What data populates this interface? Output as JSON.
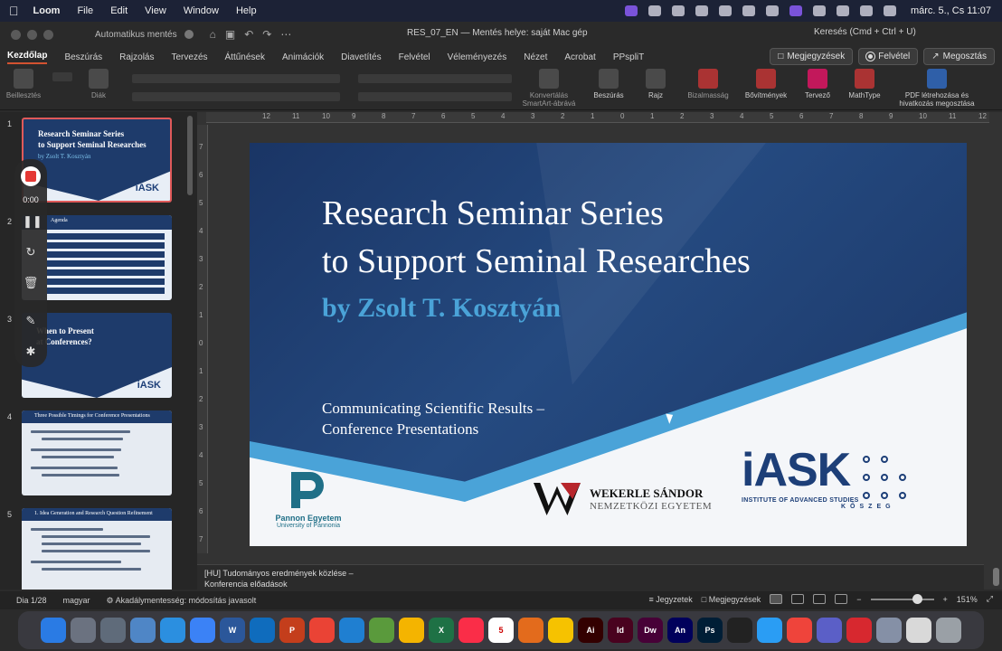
{
  "menubar": {
    "app": "Loom",
    "items": [
      "File",
      "Edit",
      "View",
      "Window",
      "Help"
    ],
    "clock": "márc. 5., Cs 11:07"
  },
  "window": {
    "autosave": "Automatikus mentés",
    "doc_title": "RES_07_EN — Mentés helye: saját Mac gép",
    "search": "Keresés (Cmd + Ctrl + U)"
  },
  "ribbon_tabs": [
    "Kezdőlap",
    "Beszúrás",
    "Rajzolás",
    "Tervezés",
    "Áttűnések",
    "Animációk",
    "Diavetítés",
    "Felvétel",
    "Véleményezés",
    "Nézet",
    "Acrobat",
    "PPspliT"
  ],
  "ribbon_actions": {
    "comments": "Megjegyzések",
    "record": "Felvétel",
    "share": "Megosztás"
  },
  "ribbon_groups": {
    "paste": "Beillesztés",
    "slides": "Diák",
    "convert": "Konvertálás\nSmartArt-ábrává",
    "insert": "Beszúrás",
    "draw": "Rajz",
    "sensitivity": "Bizalmasság",
    "addins": "Bővítmények",
    "designer": "Tervező",
    "mathtype": "MathType",
    "pdf": "PDF létrehozása és\nhivatkozás megosztása"
  },
  "recorder": {
    "time": "0:00"
  },
  "thumbnails": [
    {
      "num": "1",
      "title": "Research Seminar Series\nto Support Seminal Researches",
      "sub": "by Zsolt T. Kosztyán"
    },
    {
      "num": "2",
      "title": "Agenda"
    },
    {
      "num": "3",
      "title": "When to Present\nat Conferences?"
    },
    {
      "num": "4",
      "title": "Three Possible Timings for Conference Presentations"
    },
    {
      "num": "5",
      "title": "1. Idea Generation and Research Question Refinement"
    }
  ],
  "ruler": {
    "top": [
      "12",
      "11",
      "10",
      "9",
      "8",
      "7",
      "6",
      "5",
      "4",
      "3",
      "2",
      "1",
      "0",
      "1",
      "2",
      "3",
      "4",
      "5",
      "6",
      "7",
      "8",
      "9",
      "10",
      "11",
      "12"
    ],
    "left": [
      "7",
      "6",
      "5",
      "4",
      "3",
      "2",
      "1",
      "0",
      "1",
      "2",
      "3",
      "4",
      "5",
      "6",
      "7"
    ]
  },
  "slide": {
    "title_line1": "Research Seminar Series",
    "title_line2": "to Support Seminal Researches",
    "author": "by Zsolt T. Kosztyán",
    "subtitle_line1": "Communicating Scientific Results –",
    "subtitle_line2": "Conference Presentations",
    "pannon_name": "Pannon Egyetem",
    "pannon_sub": "University of Pannonia",
    "wekerle_1": "WEKERLE SÁNDOR",
    "wekerle_2": "NEMZETKÖZI EGYETEM",
    "iask": "iASK",
    "iask_inst": "INSTITUTE OF ADVANCED STUDIES",
    "iask_city": "KŐSZEG",
    "colors": {
      "navy": "#1c3a6a",
      "accent": "#4aa3d8",
      "iask": "#1d3f78"
    }
  },
  "notes": {
    "line1": "[HU] Tudományos eredmények közlése –",
    "line2": "Konferencia előadások"
  },
  "statusbar": {
    "slide": "Dia 1/28",
    "lang": "magyar",
    "accessibility": "Akadálymentesség: módosítás javasolt",
    "notes": "Jegyzetek",
    "comments": "Megjegyzések",
    "zoom": "151%"
  },
  "dock": [
    {
      "name": "Finder",
      "color": "#2a7be4"
    },
    {
      "name": "Launchpad",
      "color": "#6b7280"
    },
    {
      "name": "System Settings",
      "color": "#5f6b7a"
    },
    {
      "name": "Preview",
      "color": "#4f86c6"
    },
    {
      "name": "Safari",
      "color": "#2b8fe0"
    },
    {
      "name": "Mail",
      "color": "#3b82f6"
    },
    {
      "name": "Word",
      "color": "#2b579a",
      "label": "W"
    },
    {
      "name": "Outlook",
      "color": "#0f6cbd"
    },
    {
      "name": "PowerPoint",
      "color": "#c43e1c",
      "label": "P"
    },
    {
      "name": "App",
      "color": "#ea4335"
    },
    {
      "name": "VS Code",
      "color": "#1f7fd1"
    },
    {
      "name": "Mathematica",
      "color": "#5a9a3c"
    },
    {
      "name": "Chrome",
      "color": "#f4b400"
    },
    {
      "name": "Excel",
      "color": "#1e7145",
      "label": "X"
    },
    {
      "name": "Music",
      "color": "#fa2d48"
    },
    {
      "name": "Calendar",
      "color": "#ffffff",
      "label": "5"
    },
    {
      "name": "MATLAB",
      "color": "#e36b1c"
    },
    {
      "name": "Drive",
      "color": "#f6c200"
    },
    {
      "name": "Illustrator",
      "color": "#330000",
      "label": "Ai"
    },
    {
      "name": "InDesign",
      "color": "#49021f",
      "label": "Id"
    },
    {
      "name": "Dreamweaver",
      "color": "#470137",
      "label": "Dw"
    },
    {
      "name": "Animate",
      "color": "#00005b",
      "label": "An"
    },
    {
      "name": "Photoshop",
      "color": "#001e36",
      "label": "Ps"
    },
    {
      "name": "DaVinci",
      "color": "#222222"
    },
    {
      "name": "Settings",
      "color": "#2a9df4"
    },
    {
      "name": "AnyDesk",
      "color": "#ef443b"
    },
    {
      "name": "Teams",
      "color": "#5b5fc7"
    },
    {
      "name": "Acrobat",
      "color": "#d7282f"
    },
    {
      "name": "Loom",
      "color": "#8590a6"
    },
    {
      "name": "Blank",
      "color": "#d9d9d9"
    },
    {
      "name": "Trash",
      "color": "#9aa0a6"
    }
  ]
}
